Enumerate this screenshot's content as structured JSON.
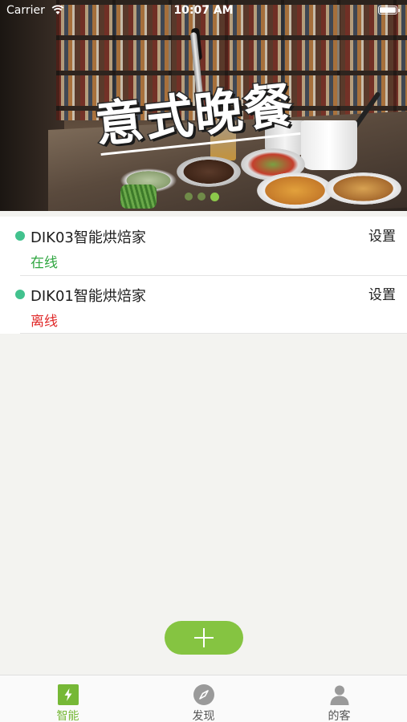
{
  "status_bar": {
    "carrier": "Carrier",
    "time": "10:07 AM"
  },
  "banner": {
    "title": "意式晚餐",
    "page_count": 3,
    "active_page": 3
  },
  "devices": [
    {
      "name": "DIK03智能烘焙家",
      "status": "在线",
      "status_kind": "online",
      "settings_label": "设置"
    },
    {
      "name": "DIK01智能烘焙家",
      "status": "离线",
      "status_kind": "offline",
      "settings_label": "设置"
    }
  ],
  "colors": {
    "accent": "#85c441",
    "online": "#2fa640",
    "offline": "#e02a2a",
    "status_dot": "#42c28e"
  },
  "add_button": {
    "icon": "plus-icon"
  },
  "tab_bar": {
    "tabs": [
      {
        "label": "智能",
        "icon": "lightning-icon",
        "active": true
      },
      {
        "label": "发现",
        "icon": "compass-icon",
        "active": false
      },
      {
        "label": "的客",
        "icon": "person-icon",
        "active": false
      }
    ]
  }
}
